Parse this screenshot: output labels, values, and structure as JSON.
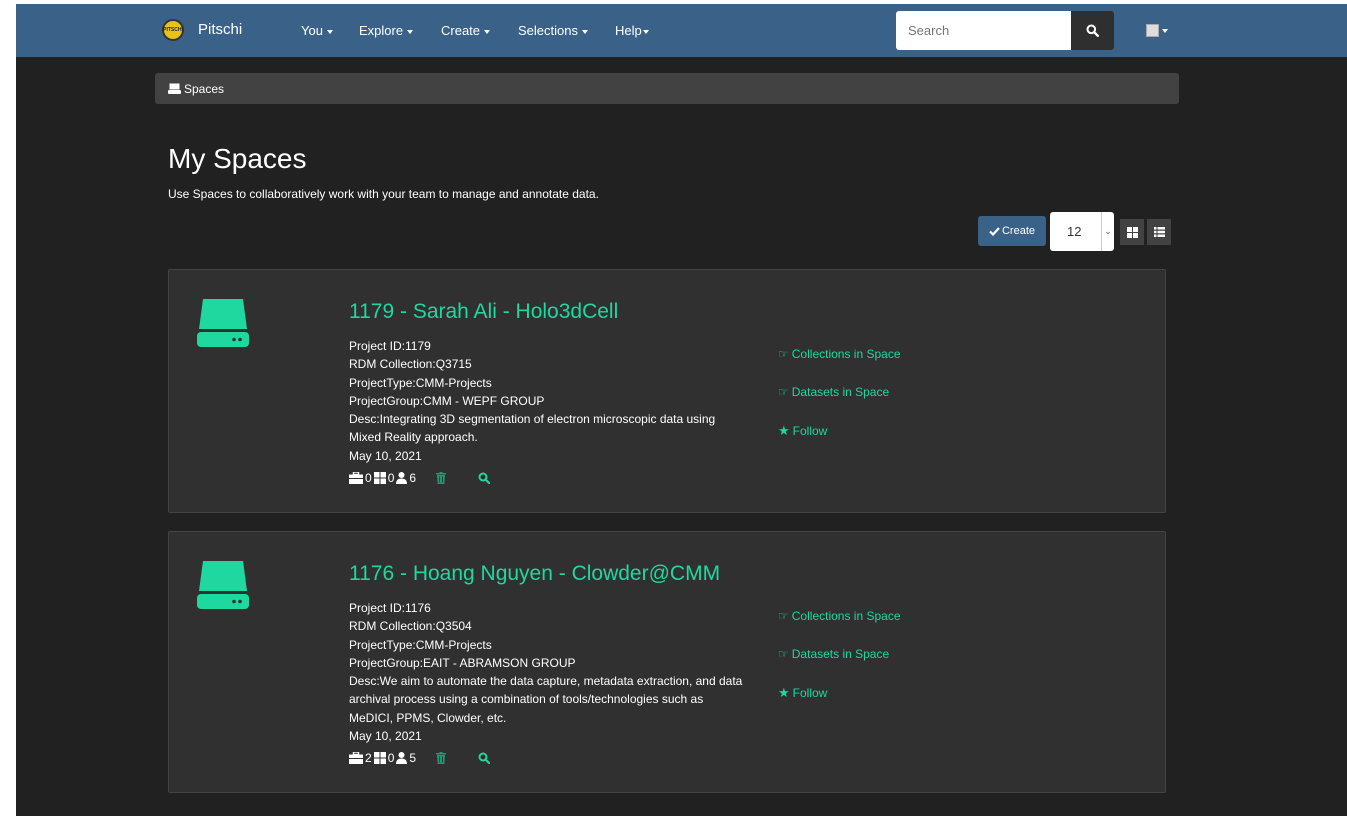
{
  "nav": {
    "brand": "Pitschi",
    "logo_text": "PITSCHI",
    "items": [
      {
        "label": "You"
      },
      {
        "label": "Explore"
      },
      {
        "label": "Create"
      },
      {
        "label": "Selections"
      },
      {
        "label": "Help"
      }
    ],
    "search_placeholder": "Search"
  },
  "breadcrumb": {
    "label": "Spaces"
  },
  "page": {
    "title": "My Spaces",
    "subtitle": "Use Spaces to collaboratively work with your team to manage and annotate data.",
    "create_label": "Create",
    "page_size": "12"
  },
  "spaces": [
    {
      "title": "1179 - Sarah Ali - Holo3dCell",
      "project_id": "Project ID:1179",
      "rdm": "RDM Collection:Q3715",
      "type": "ProjectType:CMM-Projects",
      "group": "ProjectGroup:CMM - WEPF GROUP",
      "desc": "Desc:Integrating 3D segmentation of electron microscopic data using Mixed Reality approach.",
      "date": "May 10, 2021",
      "collections": "0",
      "datasets": "0",
      "users": "6",
      "links": {
        "collections": "Collections in Space",
        "datasets": "Datasets in Space",
        "follow": "Follow"
      }
    },
    {
      "title": "1176 - Hoang Nguyen - Clowder@CMM",
      "project_id": "Project ID:1176",
      "rdm": "RDM Collection:Q3504",
      "type": "ProjectType:CMM-Projects",
      "group": "ProjectGroup:EAIT - ABRAMSON GROUP",
      "desc": "Desc:We aim to automate the data capture, metadata extraction, and data archival process using a combination of tools/technologies such as MeDICI, PPMS, Clowder, etc.",
      "date": "May 10, 2021",
      "collections": "2",
      "datasets": "0",
      "users": "5",
      "links": {
        "collections": "Collections in Space",
        "datasets": "Datasets in Space",
        "follow": "Follow"
      }
    }
  ],
  "colors": {
    "accent": "#1ed8a0",
    "navbar": "#3a6289",
    "background": "#212121",
    "card": "#303030"
  }
}
